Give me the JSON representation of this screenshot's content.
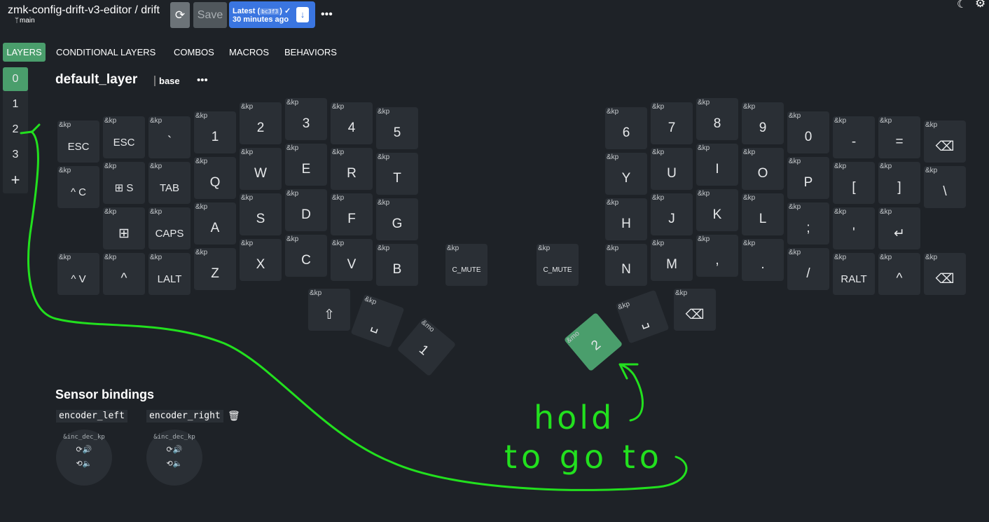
{
  "header": {
    "repo": "zmk-config-drift-v3-editor",
    "keyboard": "/ drift",
    "branch": "main",
    "save_label": "Save",
    "latest_label": "Latest (",
    "latest_hash": "bc3f3",
    "latest_check": ")",
    "latest_time": "30 minutes ago",
    "more": "•••"
  },
  "tabs": [
    "LAYERS",
    "CONDITIONAL LAYERS",
    "COMBOS",
    "MACROS",
    "BEHAVIORS"
  ],
  "layers": [
    "0",
    "1",
    "2",
    "3",
    "+"
  ],
  "layer": {
    "name": "default_layer",
    "display": "base",
    "more": "•••"
  },
  "keys": [
    {
      "b": "&kp",
      "l": "ESC"
    },
    {
      "b": "&kp",
      "l": "ESC"
    },
    {
      "b": "&kp",
      "l": "`"
    },
    {
      "b": "&kp",
      "l": "1"
    },
    {
      "b": "&kp",
      "l": "2"
    },
    {
      "b": "&kp",
      "l": "3"
    },
    {
      "b": "&kp",
      "l": "4"
    },
    {
      "b": "&kp",
      "l": "5"
    },
    {
      "b": "&kp",
      "l": "6"
    },
    {
      "b": "&kp",
      "l": "7"
    },
    {
      "b": "&kp",
      "l": "8"
    },
    {
      "b": "&kp",
      "l": "9"
    },
    {
      "b": "&kp",
      "l": "0"
    },
    {
      "b": "&kp",
      "l": "-"
    },
    {
      "b": "&kp",
      "l": "="
    },
    {
      "b": "&kp",
      "l": "⌫"
    },
    {
      "b": "&kp",
      "l": "^ C"
    },
    {
      "b": "&kp",
      "l": "⊞ S"
    },
    {
      "b": "&kp",
      "l": "TAB"
    },
    {
      "b": "&kp",
      "l": "Q"
    },
    {
      "b": "&kp",
      "l": "W"
    },
    {
      "b": "&kp",
      "l": "E"
    },
    {
      "b": "&kp",
      "l": "R"
    },
    {
      "b": "&kp",
      "l": "T"
    },
    {
      "b": "&kp",
      "l": "Y"
    },
    {
      "b": "&kp",
      "l": "U"
    },
    {
      "b": "&kp",
      "l": "I"
    },
    {
      "b": "&kp",
      "l": "O"
    },
    {
      "b": "&kp",
      "l": "P"
    },
    {
      "b": "&kp",
      "l": "["
    },
    {
      "b": "&kp",
      "l": "]"
    },
    {
      "b": "&kp",
      "l": "\\"
    },
    {
      "b": "&kp",
      "l": "⊞"
    },
    {
      "b": "&kp",
      "l": "CAPS"
    },
    {
      "b": "&kp",
      "l": "A"
    },
    {
      "b": "&kp",
      "l": "S"
    },
    {
      "b": "&kp",
      "l": "D"
    },
    {
      "b": "&kp",
      "l": "F"
    },
    {
      "b": "&kp",
      "l": "G"
    },
    {
      "b": "&kp",
      "l": "H"
    },
    {
      "b": "&kp",
      "l": "J"
    },
    {
      "b": "&kp",
      "l": "K"
    },
    {
      "b": "&kp",
      "l": "L"
    },
    {
      "b": "&kp",
      "l": ";"
    },
    {
      "b": "&kp",
      "l": "'"
    },
    {
      "b": "&kp",
      "l": "↵"
    },
    {
      "b": "&kp",
      "l": "^ V"
    },
    {
      "b": "&kp",
      "l": "^"
    },
    {
      "b": "&kp",
      "l": "LALT"
    },
    {
      "b": "&kp",
      "l": "Z"
    },
    {
      "b": "&kp",
      "l": "X"
    },
    {
      "b": "&kp",
      "l": "C"
    },
    {
      "b": "&kp",
      "l": "V"
    },
    {
      "b": "&kp",
      "l": "B"
    },
    {
      "b": "&kp",
      "l": "C_MUTE"
    },
    {
      "b": "&kp",
      "l": "C_MUTE"
    },
    {
      "b": "&kp",
      "l": "N"
    },
    {
      "b": "&kp",
      "l": "M"
    },
    {
      "b": "&kp",
      "l": ","
    },
    {
      "b": "&kp",
      "l": "."
    },
    {
      "b": "&kp",
      "l": "/"
    },
    {
      "b": "&kp",
      "l": "RALT"
    },
    {
      "b": "&kp",
      "l": "^"
    },
    {
      "b": "&kp",
      "l": "⌫"
    },
    {
      "b": "&kp",
      "l": "⇧"
    },
    {
      "b": "&kp",
      "l": "␣"
    },
    {
      "b": "&mo",
      "l": "1"
    },
    {
      "b": "&mo",
      "l": "2"
    },
    {
      "b": "&kp",
      "l": "␣"
    },
    {
      "b": "&kp",
      "l": "⌫"
    }
  ],
  "sensor": {
    "title": "Sensor bindings",
    "left": {
      "name": "encoder_left",
      "binding": "&inc_dec_kp",
      "cw": "⟳🔊",
      "ccw": "⟲🔈"
    },
    "right": {
      "name": "encoder_right",
      "binding": "&inc_dec_kp",
      "cw": "⟳🔊",
      "ccw": "⟲🔈"
    }
  },
  "annotation": {
    "line1": "hold",
    "line2": "to go to"
  },
  "colors": {
    "background": "#1e2227",
    "key": "#2a2f35",
    "accent": "#4a9e6c",
    "badge": "#3a75e0",
    "annotation": "#22e01e"
  }
}
